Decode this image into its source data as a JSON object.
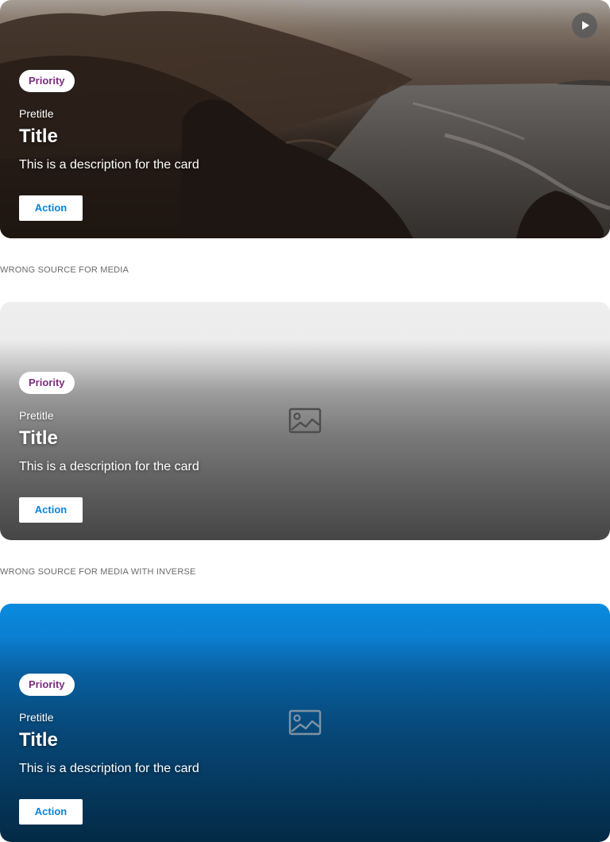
{
  "cards": [
    {
      "badge": "Priority",
      "pretitle": "Pretitle",
      "title": "Title",
      "description": "This is a description for the card",
      "action": "Action",
      "media": "video",
      "icon": "play-icon"
    },
    {
      "badge": "Priority",
      "pretitle": "Pretitle",
      "title": "Title",
      "description": "This is a description for the card",
      "action": "Action",
      "media": "broken-image",
      "icon": "image-placeholder-icon"
    },
    {
      "badge": "Priority",
      "pretitle": "Pretitle",
      "title": "Title",
      "description": "This is a description for the card",
      "action": "Action",
      "media": "broken-image-inverse",
      "icon": "image-placeholder-icon"
    }
  ],
  "sections": {
    "wrong_source": "WRONG SOURCE FOR MEDIA",
    "wrong_source_inverse": "WRONG SOURCE FOR MEDIA WITH INVERSE"
  },
  "colors": {
    "badge_text": "#7b2d7e",
    "action_text": "#0b84d6",
    "inverse_background": "#0a8bdf"
  }
}
